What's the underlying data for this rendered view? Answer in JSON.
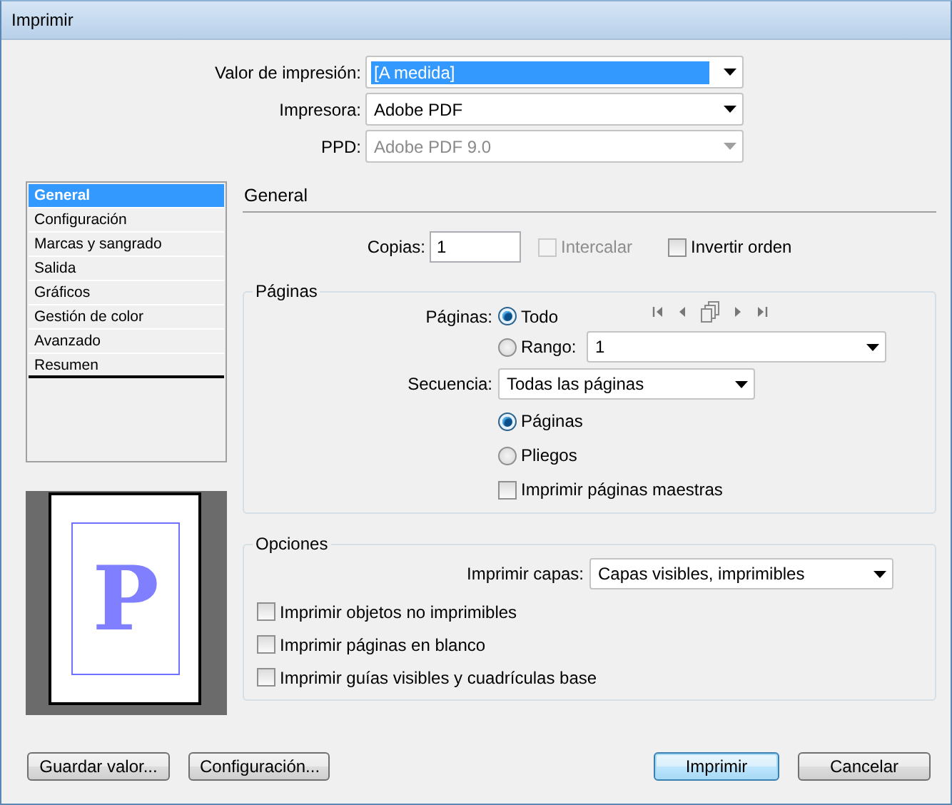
{
  "window": {
    "title": "Imprimir"
  },
  "top_fields": [
    {
      "label": "Valor de impresión:",
      "value": "[A medida]",
      "highlighted": true,
      "disabled": false
    },
    {
      "label": "Impresora:",
      "value": "Adobe PDF",
      "highlighted": false,
      "disabled": false
    },
    {
      "label": "PPD:",
      "value": "Adobe PDF 9.0",
      "highlighted": false,
      "disabled": true
    }
  ],
  "sidebar": {
    "items": [
      {
        "label": "General",
        "selected": true
      },
      {
        "label": "Configuración",
        "selected": false
      },
      {
        "label": "Marcas y sangrado",
        "selected": false
      },
      {
        "label": "Salida",
        "selected": false
      },
      {
        "label": "Gráficos",
        "selected": false
      },
      {
        "label": "Gestión de color",
        "selected": false
      },
      {
        "label": "Avanzado",
        "selected": false
      },
      {
        "label": "Resumen",
        "selected": false
      }
    ]
  },
  "preview": {
    "letter": "P"
  },
  "panel": {
    "title": "General",
    "copies": {
      "label": "Copias:",
      "value": "1"
    },
    "collate": {
      "label": "Intercalar",
      "checked": false,
      "disabled": true
    },
    "reverse": {
      "label": "Invertir orden",
      "checked": false,
      "disabled": false
    },
    "pages_group": {
      "title": "Páginas",
      "pages_label": "Páginas:",
      "range_options": [
        {
          "label": "Todo",
          "selected": true
        },
        {
          "label": "Rango:",
          "selected": false
        }
      ],
      "range_value": "1",
      "sequence": {
        "label": "Secuencia:",
        "value": "Todas las páginas"
      },
      "layout_options": [
        {
          "label": "Páginas",
          "selected": true
        },
        {
          "label": "Pliegos",
          "selected": false
        }
      ],
      "master_pages": {
        "label": "Imprimir páginas maestras",
        "checked": false
      }
    },
    "options_group": {
      "title": "Opciones",
      "layers": {
        "label": "Imprimir capas:",
        "value": "Capas visibles, imprimibles"
      },
      "checks": [
        {
          "label": "Imprimir objetos no imprimibles",
          "checked": false
        },
        {
          "label": "Imprimir páginas en blanco",
          "checked": false
        },
        {
          "label": "Imprimir guías visibles y cuadrículas base",
          "checked": false
        }
      ]
    }
  },
  "left_buttons": [
    {
      "label": "Guardar valor...",
      "default": false
    },
    {
      "label": "Configuración...",
      "default": false
    }
  ],
  "right_buttons": [
    {
      "label": "Imprimir",
      "default": true
    },
    {
      "label": "Cancelar",
      "default": false
    }
  ]
}
